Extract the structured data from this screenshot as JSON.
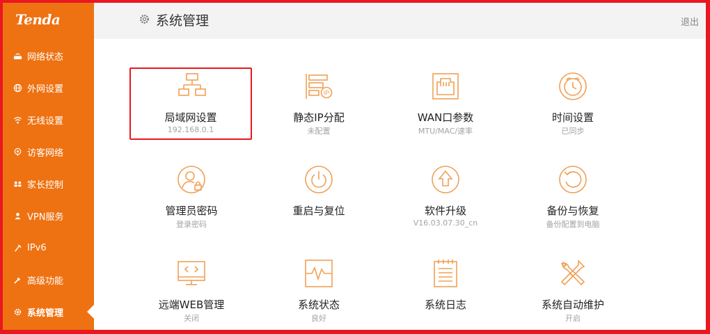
{
  "brand": {
    "logo": "Tenda",
    "accent": "#ee7212",
    "highlight": "#e9171f"
  },
  "sidebar": {
    "items": [
      {
        "label": "网络状态",
        "icon": "router-icon"
      },
      {
        "label": "外网设置",
        "icon": "globe-icon"
      },
      {
        "label": "无线设置",
        "icon": "wifi-icon"
      },
      {
        "label": "访客网络",
        "icon": "guest-icon"
      },
      {
        "label": "家长控制",
        "icon": "family-icon"
      },
      {
        "label": "VPN服务",
        "icon": "vpn-icon"
      },
      {
        "label": "IPv6",
        "icon": "ipv6-icon"
      },
      {
        "label": "高级功能",
        "icon": "tools-icon"
      },
      {
        "label": "系统管理",
        "icon": "gear-icon",
        "active": true
      }
    ]
  },
  "header": {
    "title": "系统管理",
    "logout": "退出"
  },
  "tiles": [
    {
      "label": "局域网设置",
      "sub": "192.168.0.1",
      "icon": "lan-topology-icon",
      "selected": true
    },
    {
      "label": "静态IP分配",
      "sub": "未配置",
      "icon": "static-ip-icon"
    },
    {
      "label": "WAN口参数",
      "sub": "MTU/MAC/速率",
      "icon": "ethernet-port-icon"
    },
    {
      "label": "时间设置",
      "sub": "已同步",
      "icon": "alarm-clock-icon"
    },
    {
      "label": "管理员密码",
      "sub": "登录密码",
      "icon": "admin-lock-icon"
    },
    {
      "label": "重启与复位",
      "sub": "",
      "icon": "power-icon"
    },
    {
      "label": "软件升级",
      "sub": "V16.03.07.30_cn",
      "icon": "upgrade-arrow-icon"
    },
    {
      "label": "备份与恢复",
      "sub": "备份配置到电脑",
      "icon": "restore-icon"
    },
    {
      "label": "远端WEB管理",
      "sub": "关闭",
      "icon": "remote-monitor-icon"
    },
    {
      "label": "系统状态",
      "sub": "良好",
      "icon": "pulse-monitor-icon"
    },
    {
      "label": "系统日志",
      "sub": "",
      "icon": "log-document-icon"
    },
    {
      "label": "系统自动维护",
      "sub": "开启",
      "icon": "wrench-screwdriver-icon"
    }
  ]
}
